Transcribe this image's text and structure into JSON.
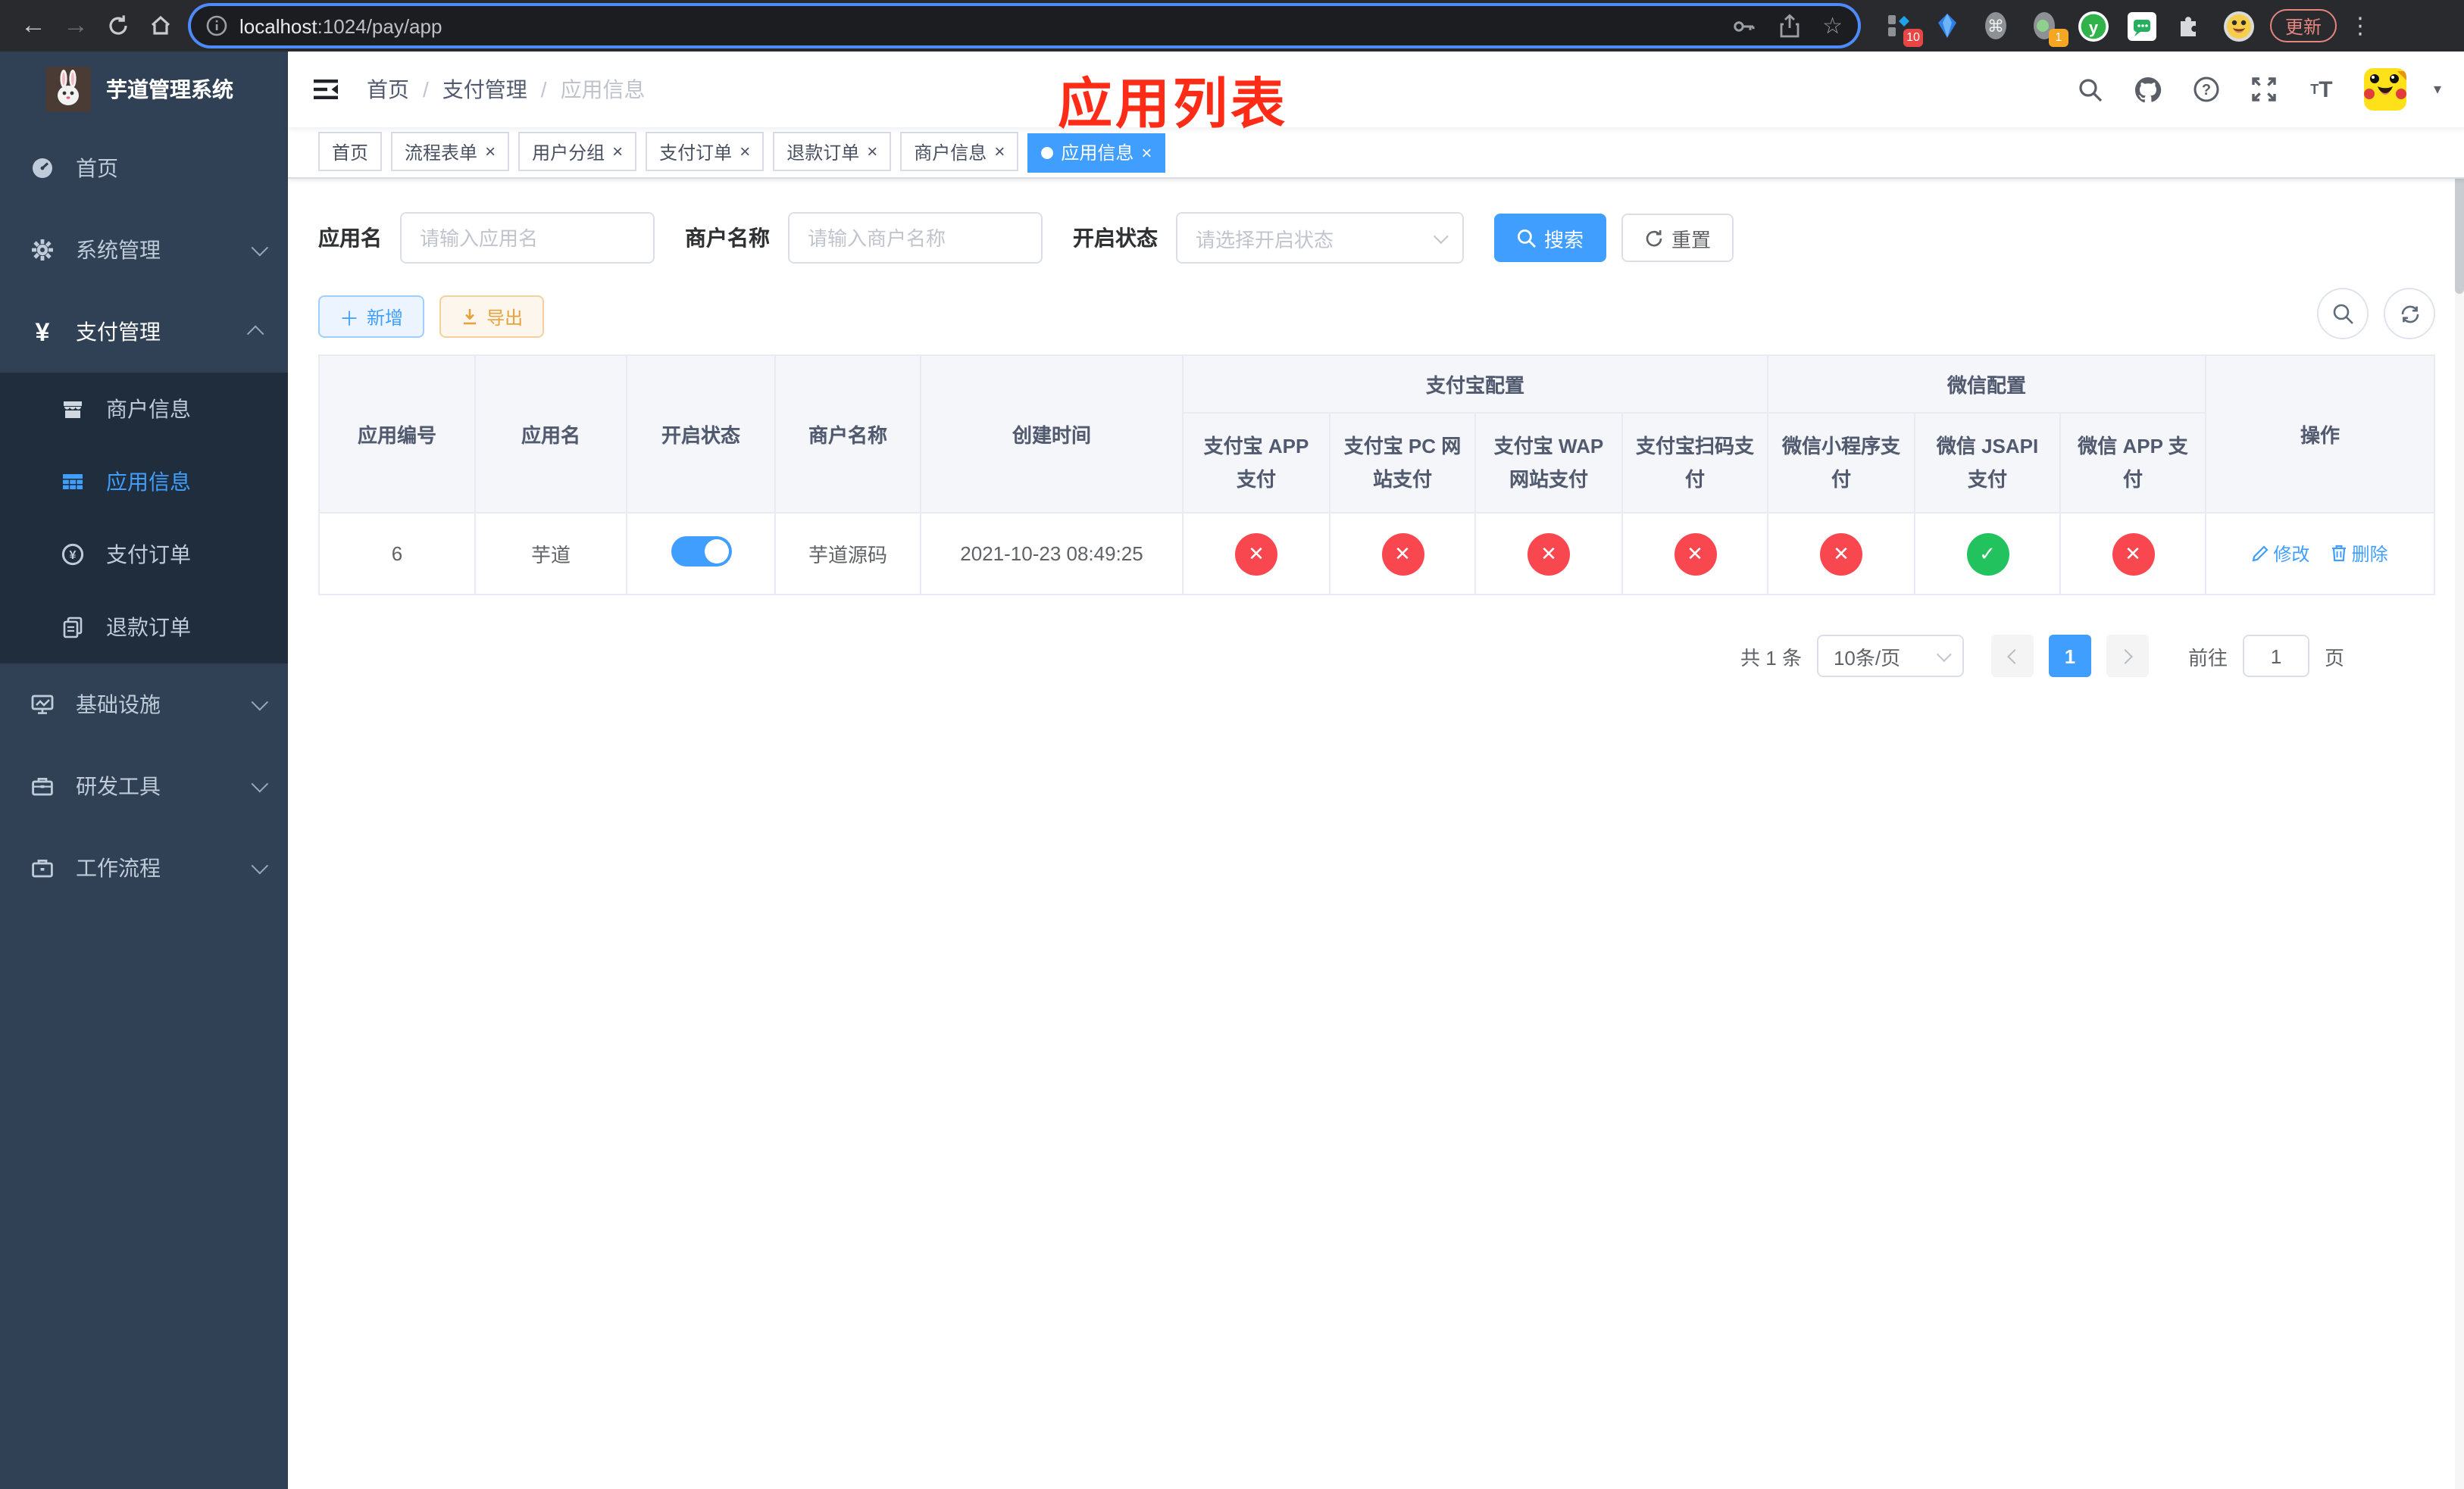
{
  "browser": {
    "url_host": "localhost",
    "url_rest": ":1024/pay/app",
    "update_label": "更新",
    "badge_ten": "10",
    "badge_one": "1"
  },
  "sidebar": {
    "title": "芋道管理系统",
    "home": "首页",
    "system": "系统管理",
    "payment": "支付管理",
    "merchant_info": "商户信息",
    "app_info": "应用信息",
    "pay_order": "支付订单",
    "refund_order": "退款订单",
    "infra": "基础设施",
    "dev_tools": "研发工具",
    "workflow": "工作流程"
  },
  "navbar": {
    "breadcrumb": [
      "首页",
      "支付管理",
      "应用信息"
    ],
    "separator": "/",
    "annotation": "应用列表"
  },
  "tabs": [
    {
      "label": "首页",
      "closable": false,
      "active": false
    },
    {
      "label": "流程表单",
      "closable": true,
      "active": false
    },
    {
      "label": "用户分组",
      "closable": true,
      "active": false
    },
    {
      "label": "支付订单",
      "closable": true,
      "active": false
    },
    {
      "label": "退款订单",
      "closable": true,
      "active": false
    },
    {
      "label": "商户信息",
      "closable": true,
      "active": false
    },
    {
      "label": "应用信息",
      "closable": true,
      "active": true
    }
  ],
  "filters": {
    "app_name_label": "应用名",
    "app_name_placeholder": "请输入应用名",
    "merchant_label": "商户名称",
    "merchant_placeholder": "请输入商户名称",
    "status_label": "开启状态",
    "status_placeholder": "请选择开启状态",
    "search_label": "搜索",
    "reset_label": "重置"
  },
  "toolbar": {
    "add_label": "新增",
    "export_label": "导出"
  },
  "table": {
    "col_id": "应用编号",
    "col_name": "应用名",
    "col_status": "开启状态",
    "col_merchant": "商户名称",
    "col_created": "创建时间",
    "group_alipay": "支付宝配置",
    "alipay_cols": [
      "支付宝 APP 支付",
      "支付宝 PC 网站支付",
      "支付宝 WAP 网站支付",
      "支付宝扫码支付"
    ],
    "group_wechat": "微信配置",
    "wechat_cols": [
      "微信小程序支付",
      "微信 JSAPI 支付",
      "微信 APP 支付"
    ],
    "col_action": "操作",
    "rows": [
      {
        "id": "6",
        "name": "芋道",
        "enabled": true,
        "merchant": "芋道源码",
        "created": "2021-10-23 08:49:25",
        "statuses": [
          "no",
          "no",
          "no",
          "no",
          "no",
          "yes",
          "no"
        ],
        "edit_label": "修改",
        "delete_label": "删除"
      }
    ]
  },
  "pagination": {
    "total": "共 1 条",
    "page_size": "10条/页",
    "current_page": "1",
    "goto_label": "前往",
    "goto_value": "1",
    "goto_suffix": "页"
  },
  "colors": {
    "primary": "#409eff",
    "success": "#22c35e",
    "danger": "#f8474f",
    "warning": "#e6a23c",
    "annotation_red": "#fe2c17",
    "sidebar_bg": "#304156",
    "submenu_bg": "#1f2d3d"
  }
}
